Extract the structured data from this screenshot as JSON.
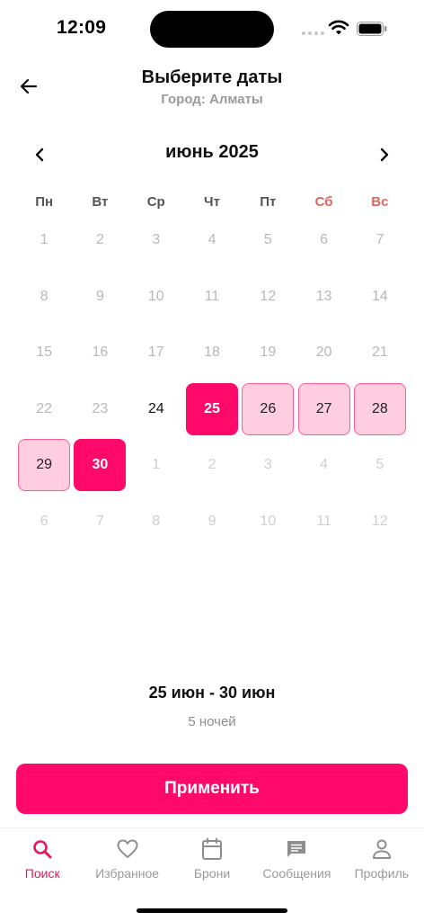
{
  "status_bar": {
    "time": "12:09"
  },
  "header": {
    "title": "Выберите даты",
    "subtitle": "Город: Алматы"
  },
  "calendar": {
    "month_title": "июнь 2025",
    "weekdays": [
      "Пн",
      "Вт",
      "Ср",
      "Чт",
      "Пт",
      "Сб",
      "Вс"
    ],
    "weekend_color": "#e0645f",
    "days": [
      {
        "label": "1",
        "state": "past"
      },
      {
        "label": "2",
        "state": "past"
      },
      {
        "label": "3",
        "state": "past"
      },
      {
        "label": "4",
        "state": "past"
      },
      {
        "label": "5",
        "state": "past"
      },
      {
        "label": "6",
        "state": "past"
      },
      {
        "label": "7",
        "state": "past"
      },
      {
        "label": "8",
        "state": "past"
      },
      {
        "label": "9",
        "state": "past"
      },
      {
        "label": "10",
        "state": "past"
      },
      {
        "label": "11",
        "state": "past"
      },
      {
        "label": "12",
        "state": "past"
      },
      {
        "label": "13",
        "state": "past"
      },
      {
        "label": "14",
        "state": "past"
      },
      {
        "label": "15",
        "state": "past"
      },
      {
        "label": "16",
        "state": "past"
      },
      {
        "label": "17",
        "state": "past"
      },
      {
        "label": "18",
        "state": "past"
      },
      {
        "label": "19",
        "state": "past"
      },
      {
        "label": "20",
        "state": "past"
      },
      {
        "label": "21",
        "state": "past"
      },
      {
        "label": "22",
        "state": "past"
      },
      {
        "label": "23",
        "state": "past"
      },
      {
        "label": "24",
        "state": "avail"
      },
      {
        "label": "25",
        "state": "edge"
      },
      {
        "label": "26",
        "state": "range"
      },
      {
        "label": "27",
        "state": "range"
      },
      {
        "label": "28",
        "state": "range"
      },
      {
        "label": "29",
        "state": "range"
      },
      {
        "label": "30",
        "state": "edge"
      },
      {
        "label": "1",
        "state": "next"
      },
      {
        "label": "2",
        "state": "next"
      },
      {
        "label": "3",
        "state": "next"
      },
      {
        "label": "4",
        "state": "next"
      },
      {
        "label": "5",
        "state": "next"
      },
      {
        "label": "6",
        "state": "next"
      },
      {
        "label": "7",
        "state": "next"
      },
      {
        "label": "8",
        "state": "next"
      },
      {
        "label": "9",
        "state": "next"
      },
      {
        "label": "10",
        "state": "next"
      },
      {
        "label": "11",
        "state": "next"
      },
      {
        "label": "12",
        "state": "next"
      }
    ]
  },
  "summary": {
    "range": "25 июн - 30 июн",
    "nights": "5 ночей"
  },
  "apply_label": "Применить",
  "accent_color": "#ff0a6b",
  "tabs": [
    {
      "key": "search",
      "label": "Поиск",
      "icon": "search-icon",
      "active": true
    },
    {
      "key": "favorites",
      "label": "Избранное",
      "icon": "heart-icon",
      "active": false
    },
    {
      "key": "bookings",
      "label": "Брони",
      "icon": "calendar-icon",
      "active": false
    },
    {
      "key": "messages",
      "label": "Сообщения",
      "icon": "message-icon",
      "active": false
    },
    {
      "key": "profile",
      "label": "Профиль",
      "icon": "person-icon",
      "active": false
    }
  ]
}
